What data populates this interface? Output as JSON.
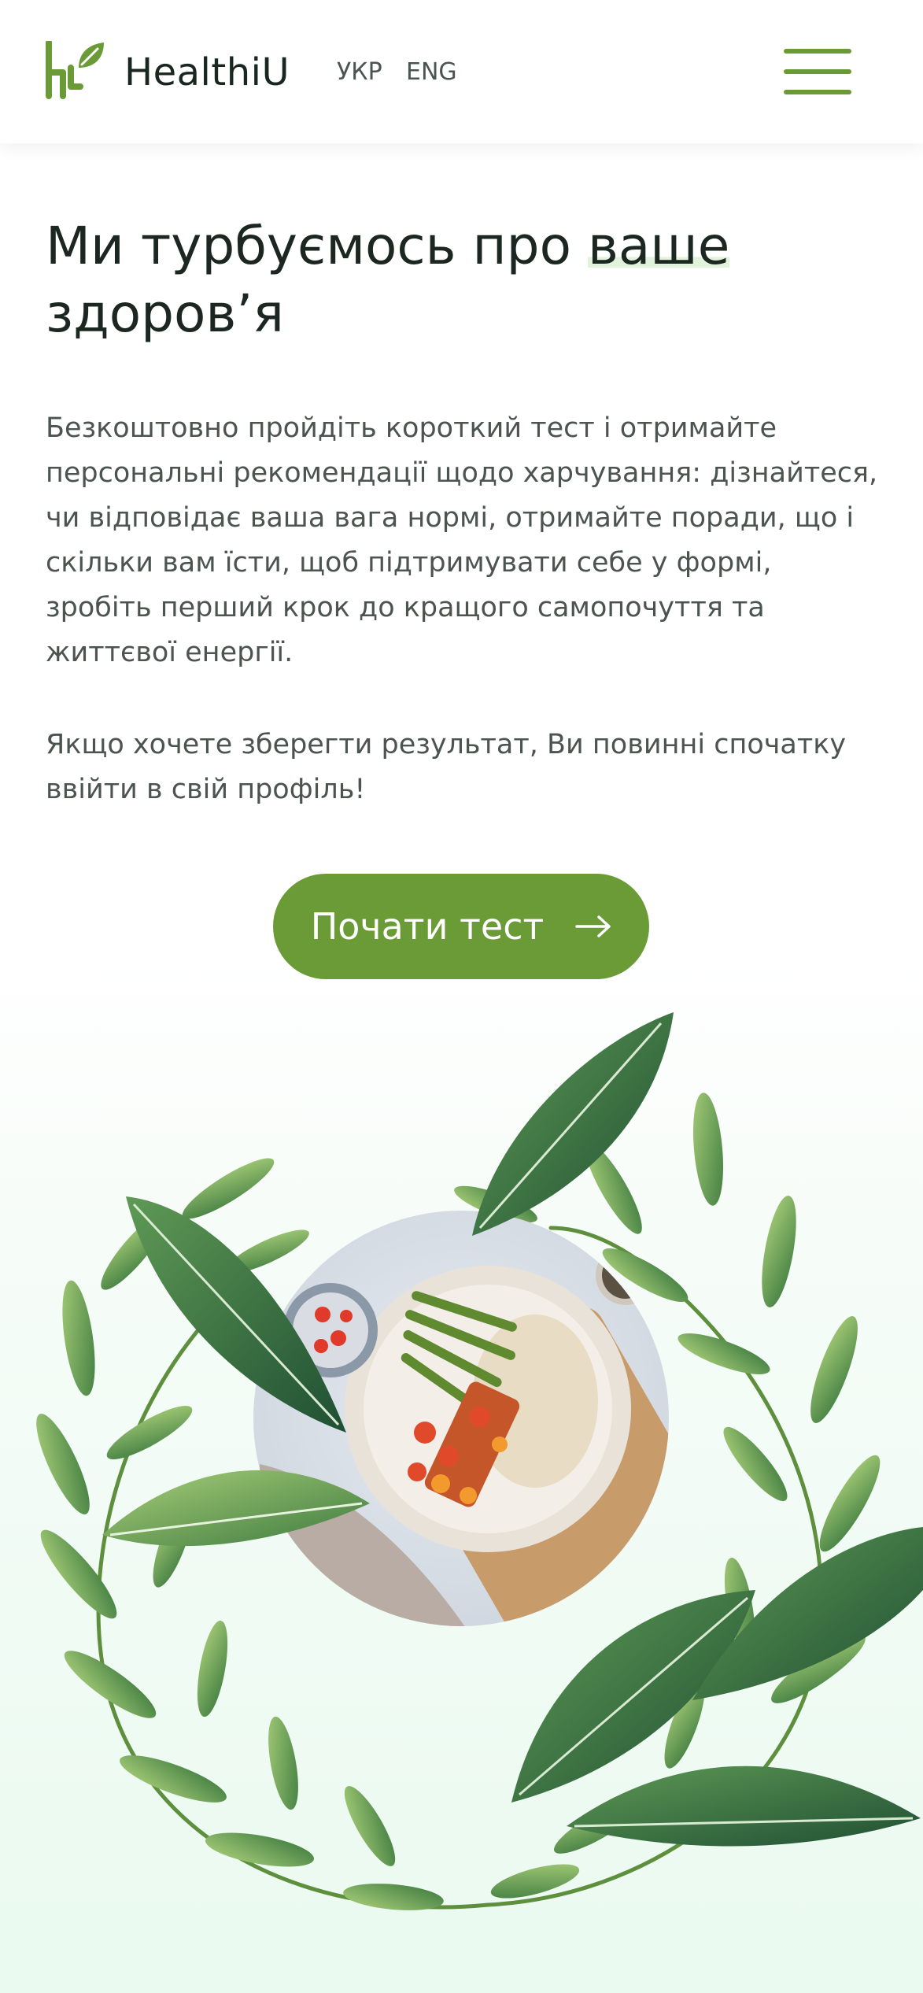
{
  "header": {
    "brand": "HealthiU",
    "lang_ukr": "УКР",
    "lang_eng": "ENG"
  },
  "hero": {
    "title_part1": "Ми турбуємось про ",
    "title_highlight": "ваше",
    "title_part2": "здоров’я",
    "description": "Безкоштовно пройдіть короткий тест і отримайте персональні рекомендації щодо харчування: дізнайтеся, чи відповідає ваша вага нормі, отримайте поради, що і скільки вам їсти, щоб підтримувати себе у формі, зробіть перший крок до кращого самопочуття та життєвої енергії.",
    "login_note": "Якщо хочете зберегти результат, Ви повинні спочатку ввійти в свій профіль!",
    "cta_label": "Почати тест"
  },
  "colors": {
    "accent": "#6b9b37",
    "leaf_dark": "#2f6a3c",
    "leaf_light": "#8cbf5a",
    "highlight": "#e2f3dc"
  },
  "icons": {
    "logo": "healthiu-logo-icon",
    "menu": "hamburger-menu-icon",
    "cta_arrow": "arrow-right-icon"
  }
}
